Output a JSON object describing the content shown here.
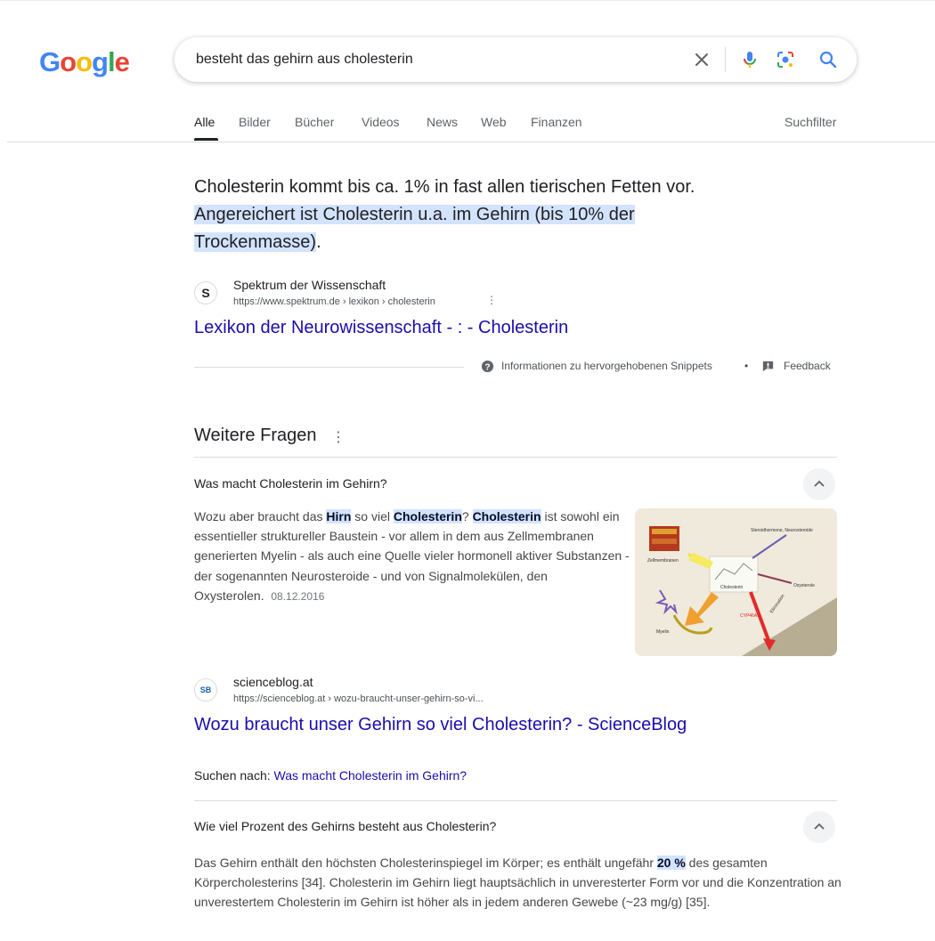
{
  "header": {
    "logo": {
      "letters": [
        {
          "char": "G",
          "color": "#4285F4"
        },
        {
          "char": "o",
          "color": "#EA4335"
        },
        {
          "char": "o",
          "color": "#FBBC05"
        },
        {
          "char": "g",
          "color": "#4285F4"
        },
        {
          "char": "l",
          "color": "#34A853"
        },
        {
          "char": "e",
          "color": "#EA4335"
        }
      ]
    },
    "search": {
      "value": "besteht das gehirn aus cholesterin",
      "icons": [
        "close-icon",
        "microphone-icon",
        "camera-lens-icon",
        "search-icon"
      ]
    }
  },
  "tabs": {
    "items": [
      {
        "label": "Alle",
        "active": true
      },
      {
        "label": "Bilder",
        "active": false
      },
      {
        "label": "Bücher",
        "active": false
      },
      {
        "label": "Videos",
        "active": false
      },
      {
        "label": "News",
        "active": false
      },
      {
        "label": "Web",
        "active": false
      },
      {
        "label": "Finanzen",
        "active": false
      }
    ],
    "filter_label": "Suchfilter"
  },
  "featured": {
    "text_plain": "Cholesterin kommt bis ca. 1% in fast allen tierischen Fetten vor. ",
    "text_highlight": "Angereichert ist Cholesterin u.a. im Gehirn (bis 10% der Trockenmasse)",
    "text_end": ".",
    "source": {
      "favicon": "S",
      "name": "Spektrum der Wissenschaft",
      "url": "https://www.spektrum.de › lexikon › cholesterin"
    },
    "title": "Lexikon der Neurowissenschaft - : - Cholesterin",
    "info_label": "Informationen zu hervorgehobenen Snippets",
    "bullet": "•",
    "feedback_label": "Feedback"
  },
  "questions": {
    "heading": "Weitere Fragen",
    "q1": {
      "question": "Was macht Cholesterin im Gehirn?",
      "answer_parts": [
        {
          "text": "Wozu aber braucht das ",
          "hl": false
        },
        {
          "text": "Hirn",
          "hl": true
        },
        {
          "text": " so viel ",
          "hl": false
        },
        {
          "text": "Cholesterin",
          "hl": true
        },
        {
          "text": "? ",
          "hl": false
        },
        {
          "text": "Cholesterin",
          "hl": true
        },
        {
          "text": " ist sowohl ein essentieller struktureller Baustein - vor allem in dem aus Zellmembranen generierten Myelin - als auch eine Quelle vieler hormonell aktiver Substanzen - der sogenannten Neurosteroide - und von Signalmolekülen, den Oxysterolen.",
          "hl": false
        }
      ],
      "date": "08.12.2016",
      "image_labels": {
        "steroid": "Steroidhormone, Neurosteroide",
        "membrane": "Zellmembranen",
        "cholesterol": "Cholesterin",
        "oxysterole": "Oxysterole",
        "myelin": "Myelin",
        "cyp": "CYP46A1",
        "elimination": "Elimination"
      },
      "source": {
        "favicon": "SB",
        "name": "scienceblog.at",
        "url": "https://scienceblog.at › wozu-braucht-unser-gehirn-so-vi..."
      },
      "title": "Wozu braucht unser Gehirn so viel Cholesterin? - ScienceBlog",
      "search_for_label": "Suchen nach: ",
      "search_for_link": "Was macht Cholesterin im Gehirn?"
    },
    "q2": {
      "question": "Wie viel Prozent des Gehirns besteht aus Cholesterin?",
      "answer_pre": "Das Gehirn enthält den höchsten Cholesterinspiegel im Körper; es enthält ungefähr ",
      "answer_hl": "20 %",
      "answer_post": " des gesamten Körpercholesterins [34]. Cholesterin im Gehirn liegt hauptsächlich in unveresterter Form vor und die Konzentration an unverestertem Cholesterin im Gehirn ist höher als in jedem anderen Gewebe (~23 mg/g) [35]."
    }
  }
}
